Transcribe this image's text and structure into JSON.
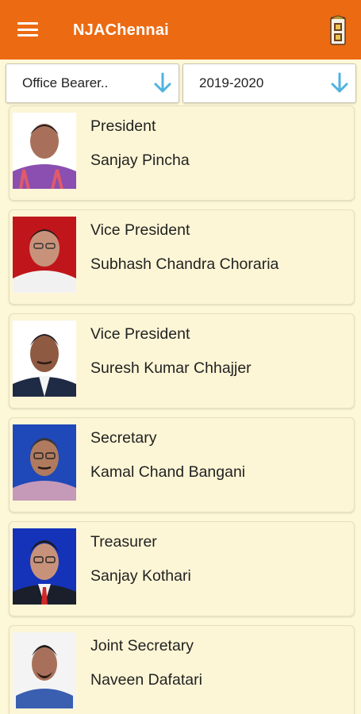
{
  "appbar": {
    "title": "NJAChennai",
    "menu_icon": "hamburger-menu-icon",
    "logo_icon": "njachennai-logo-icon",
    "color": "#ec6a12"
  },
  "filters": {
    "category": {
      "value": "Office Bearer..",
      "icon": "arrow-down-icon"
    },
    "year": {
      "value": "2019-2020",
      "icon": "arrow-down-icon"
    },
    "arrow_color": "#4fb3e0"
  },
  "members": [
    {
      "designation": "President",
      "name": "Sanjay Pincha",
      "photo_bg": "#ffffff"
    },
    {
      "designation": "Vice President",
      "name": "Subhash Chandra Choraria",
      "photo_bg": "#c0161b"
    },
    {
      "designation": "Vice President",
      "name": "Suresh Kumar Chhajjer",
      "photo_bg": "#ffffff"
    },
    {
      "designation": "Secretary",
      "name": "Kamal Chand Bangani",
      "photo_bg": "#1f48b8"
    },
    {
      "designation": "Treasurer",
      "name": "Sanjay Kothari",
      "photo_bg": "#1433b8"
    },
    {
      "designation": "Joint Secretary",
      "name": "Naveen Dafatari",
      "photo_bg": "#f4f4f4"
    }
  ]
}
